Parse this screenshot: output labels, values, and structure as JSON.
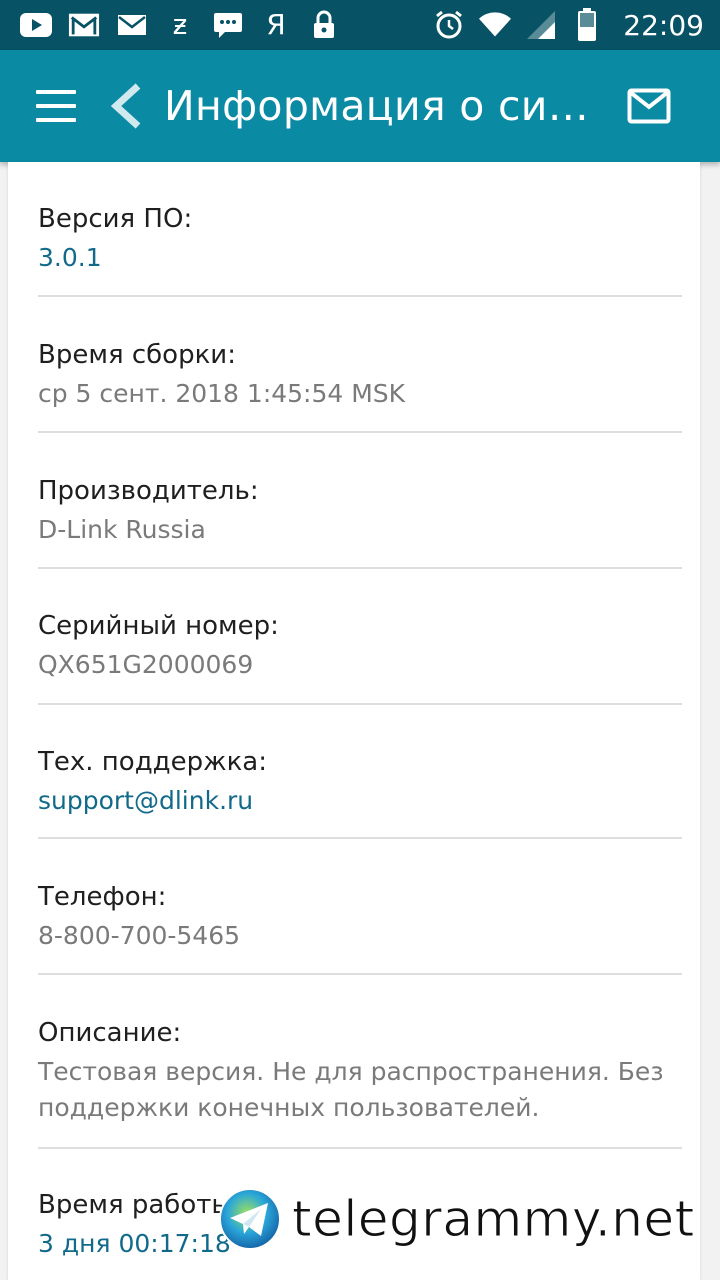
{
  "status_bar": {
    "time": "22:09",
    "icons_left": [
      "youtube-icon",
      "gmail-icon",
      "mail-icon",
      "zen-icon",
      "chat-icon",
      "yandex-icon",
      "lock-icon"
    ],
    "yandex_glyph": "Я",
    "zen_glyph": "ƶ",
    "icons_right": [
      "alarm-icon",
      "wifi-icon",
      "signal-icon",
      "battery-icon"
    ],
    "battery_level": "43"
  },
  "app_bar": {
    "title": "Информация о сис...",
    "menu_icon": "hamburger-icon",
    "back_icon": "chevron-left-icon",
    "action_icon": "mail-icon"
  },
  "info": {
    "rows": [
      {
        "label": "Версия ПО:",
        "value": "3.0.1",
        "style": "link"
      },
      {
        "label": "Время сборки:",
        "value": "ср 5 сент. 2018 1:45:54 MSK",
        "style": "plain"
      },
      {
        "label": "Производитель:",
        "value": "D-Link Russia",
        "style": "plain"
      },
      {
        "label": "Серийный номер:",
        "value": "QX651G2000069",
        "style": "plain"
      },
      {
        "label": "Тех. поддержка:",
        "value": "support@dlink.ru",
        "style": "link"
      },
      {
        "label": "Телефон:",
        "value": "8-800-700-5465",
        "style": "plain"
      },
      {
        "label": "Описание:",
        "value": "Тестовая версия. Не для распространения. Без поддержки конечных пользователей.",
        "style": "plain"
      },
      {
        "label": "Время работы:",
        "value": "3 дня 00:17:18",
        "style": "link"
      }
    ]
  },
  "watermark": {
    "text": "telegrammy.net"
  },
  "colors": {
    "status_bar": "#075264",
    "app_bar": "#0a8aa3",
    "link": "#126a8a",
    "value_gray": "#7a7a7a"
  }
}
